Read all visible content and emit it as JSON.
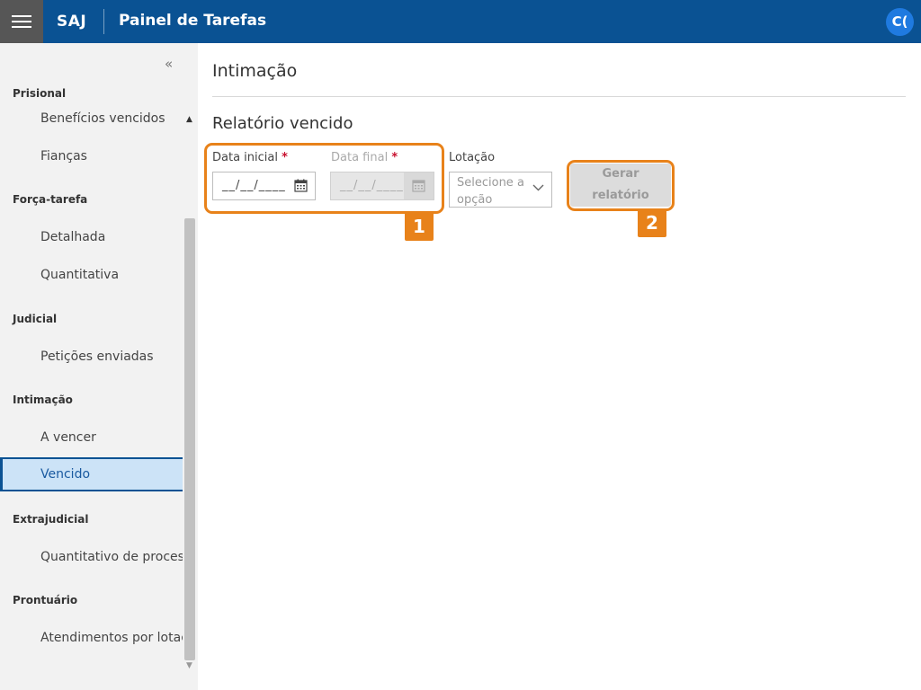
{
  "header": {
    "brand": "SAJ",
    "title": "Painel de Tarefas",
    "user_initials": "C(",
    "menu_icon": "hamburger-menu-icon",
    "color": "#0a5293"
  },
  "sidebar": {
    "collapse_icon": "«",
    "groups": [
      {
        "label": "Prisional",
        "items": [
          "Benefícios vencidos",
          "Fianças"
        ]
      },
      {
        "label": "Força-tarefa",
        "items": [
          "Detalhada",
          "Quantitativa"
        ]
      },
      {
        "label": "Judicial",
        "items": [
          "Petições enviadas"
        ]
      },
      {
        "label": "Intimação",
        "items": [
          "A vencer",
          "Vencido"
        ]
      },
      {
        "label": "Extrajudicial",
        "items": [
          "Quantitativo de processo"
        ]
      },
      {
        "label": "Prontuário",
        "items": [
          "Atendimentos por lotação"
        ]
      }
    ],
    "active_item": "Vencido"
  },
  "main": {
    "page_title": "Intimação",
    "section_title": "Relatório vencido",
    "fields": {
      "data_inicial": {
        "label": "Data inicial",
        "required_mark": "*",
        "value": "__/__/____",
        "enabled": true
      },
      "data_final": {
        "label": "Data final",
        "required_mark": "*",
        "value": "__/__/____",
        "enabled": false
      },
      "lotacao": {
        "label": "Lotação",
        "placeholder": "Selecione a opção"
      }
    },
    "generate_button": {
      "label_line1": "Gerar",
      "label_line2": "relatório",
      "enabled": false
    }
  },
  "annotations": {
    "callout_1": "1",
    "callout_2": "2",
    "color": "#e8821a"
  }
}
